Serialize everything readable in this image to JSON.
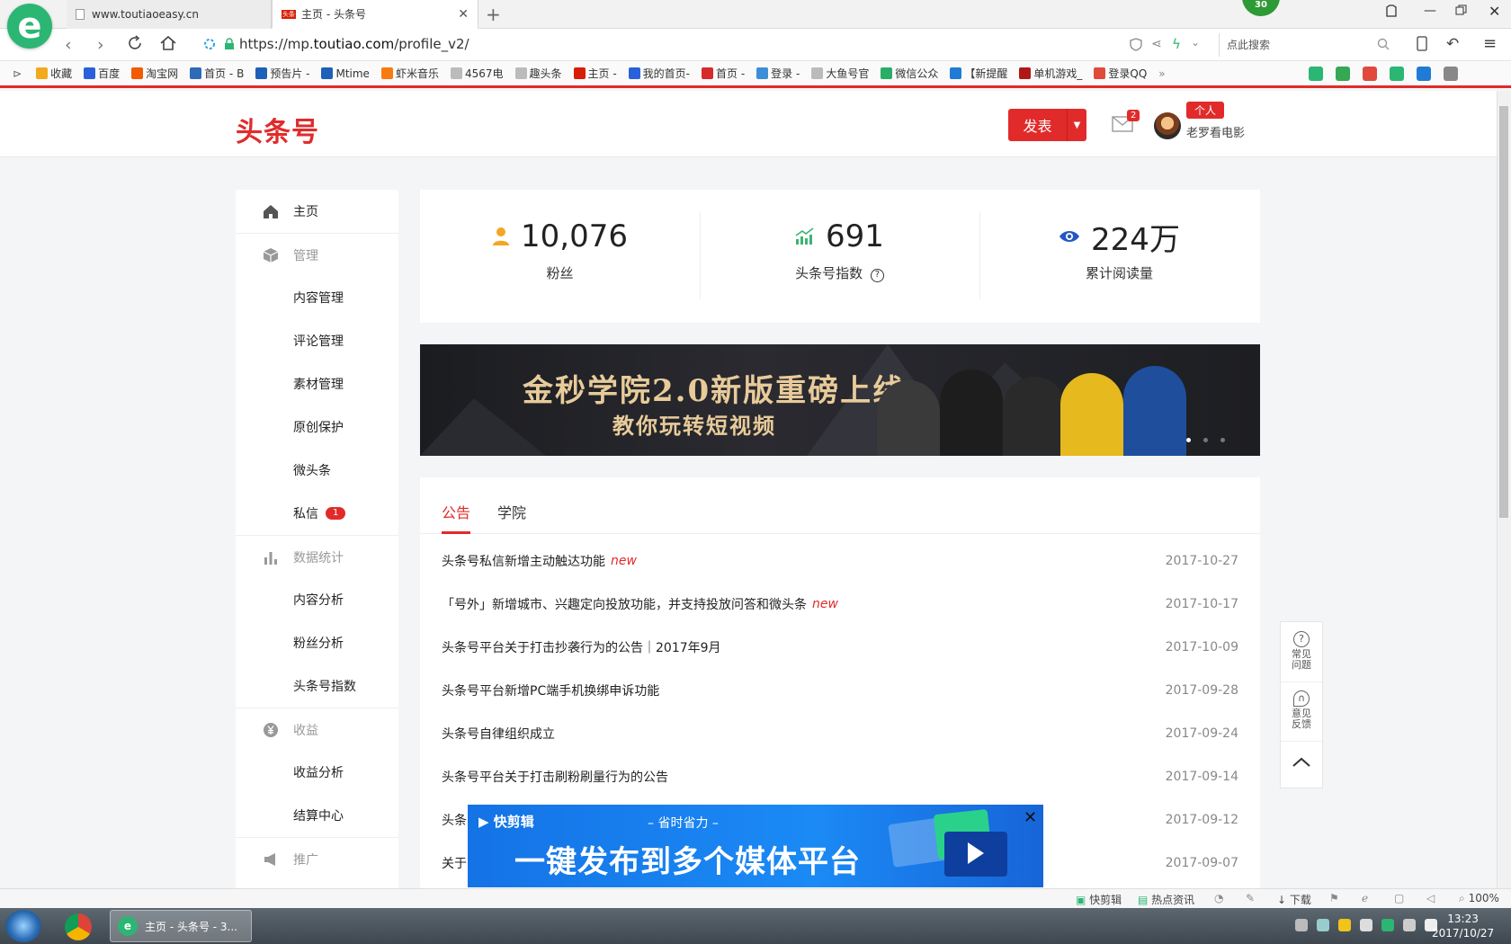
{
  "browser": {
    "tabs": [
      {
        "title": "www.toutiaoeasy.cn"
      },
      {
        "title": "主页 - 头条号"
      }
    ],
    "badge": "30",
    "url_prefix": "https://mp.",
    "url_host": "toutiao.com",
    "url_path": "/profile_v2/",
    "search_placeholder": "点此搜索",
    "bookmarks": [
      {
        "label": "收藏",
        "icon": "star-icon",
        "color": "#f2a91d"
      },
      {
        "label": "百度",
        "icon": "baidu-icon",
        "color": "#2a61db"
      },
      {
        "label": "淘宝网",
        "icon": "taobao-icon",
        "color": "#f25a06"
      },
      {
        "label": "首页 - B",
        "icon": "bilibili-icon",
        "color": "#2d6bb6"
      },
      {
        "label": "预告片 -",
        "icon": "mtime-icon",
        "color": "#1e5fb8"
      },
      {
        "label": "Mtime",
        "icon": "mtime-icon",
        "color": "#1e5fb8"
      },
      {
        "label": "虾米音乐",
        "icon": "xiami-icon",
        "color": "#f77b10"
      },
      {
        "label": "4567电",
        "icon": "page-icon",
        "color": "#bbbbbb"
      },
      {
        "label": "趣头条",
        "icon": "page-icon",
        "color": "#bbbbbb"
      },
      {
        "label": "主页 -",
        "icon": "toutiao-icon",
        "color": "#d81e06"
      },
      {
        "label": "我的首页-",
        "icon": "paw-icon",
        "color": "#2a61db"
      },
      {
        "label": "首页 -",
        "icon": "weibo-icon",
        "color": "#d52c2b"
      },
      {
        "label": "登录 -",
        "icon": "m-icon",
        "color": "#3c8fd6"
      },
      {
        "label": "大鱼号官",
        "icon": "page-icon",
        "color": "#bbbbbb"
      },
      {
        "label": "微信公众",
        "icon": "wechat-icon",
        "color": "#2aae67"
      },
      {
        "label": "【新提醒",
        "icon": "bell-icon",
        "color": "#1f7bd6"
      },
      {
        "label": "单机游戏_",
        "icon": "game-icon",
        "color": "#b01818"
      },
      {
        "label": "登录QQ",
        "icon": "chrome-icon",
        "color": "#e04a3b"
      }
    ]
  },
  "header": {
    "brand": "头条号",
    "publish_label": "发表",
    "mail_count": "2",
    "user_type": "个人",
    "username": "老罗看电影"
  },
  "sidebar": {
    "items": [
      {
        "label": "主页",
        "group": true
      },
      {
        "label": "管理",
        "group": true
      },
      {
        "label": "内容管理"
      },
      {
        "label": "评论管理"
      },
      {
        "label": "素材管理"
      },
      {
        "label": "原创保护"
      },
      {
        "label": "微头条"
      },
      {
        "label": "私信",
        "badge": "1"
      },
      {
        "label": "数据统计",
        "group": true
      },
      {
        "label": "内容分析"
      },
      {
        "label": "粉丝分析"
      },
      {
        "label": "头条号指数"
      },
      {
        "label": "收益",
        "group": true
      },
      {
        "label": "收益分析"
      },
      {
        "label": "结算中心"
      },
      {
        "label": "推广",
        "group": true
      }
    ]
  },
  "stats": [
    {
      "value": "10,076",
      "label": "粉丝",
      "icon": "user-icon",
      "color": "#f5a623"
    },
    {
      "value": "691",
      "label": "头条号指数",
      "icon": "chart-up-icon",
      "color": "#3cb371"
    },
    {
      "value": "224万",
      "label": "累计阅读量",
      "icon": "eye-icon",
      "color": "#2457c5"
    }
  ],
  "banner": {
    "title": "金秒学院2.0新版重磅上线",
    "subtitle": "教你玩转短视频"
  },
  "notices": {
    "tabs": [
      "公告",
      "学院"
    ],
    "new_label": "new",
    "items": [
      {
        "title": "头条号私信新增主动触达功能",
        "new": true,
        "date": "2017-10-27"
      },
      {
        "title": "「号外」新增城市、兴趣定向投放功能，并支持投放问答和微头条",
        "new": true,
        "date": "2017-10-17"
      },
      {
        "title": "头条号平台关于打击抄袭行为的公告｜2017年9月",
        "new": false,
        "date": "2017-10-09"
      },
      {
        "title": "头条号平台新增PC端手机换绑申诉功能",
        "new": false,
        "date": "2017-09-28"
      },
      {
        "title": "头条号自律组织成立",
        "new": false,
        "date": "2017-09-24"
      },
      {
        "title": "头条号平台关于打击刷粉刷量行为的公告",
        "new": false,
        "date": "2017-09-14"
      },
      {
        "title": "头条",
        "new": false,
        "date": "2017-09-12"
      },
      {
        "title": "关于",
        "new": false,
        "date": "2017-09-07"
      }
    ]
  },
  "help": {
    "faq": "常见问题",
    "feedback": "意见反馈"
  },
  "ad": {
    "brand": "快剪辑",
    "tagline": "– 省时省力 –",
    "headline": "一键发布到多个媒体平台"
  },
  "statusbar": {
    "quick_edit": "快剪辑",
    "hot_news": "热点资讯",
    "download": "下载",
    "zoom": "100%"
  },
  "taskbar": {
    "task_title": "主页 - 头条号 - 3...",
    "time": "13:23",
    "date": "2017/10/27"
  }
}
